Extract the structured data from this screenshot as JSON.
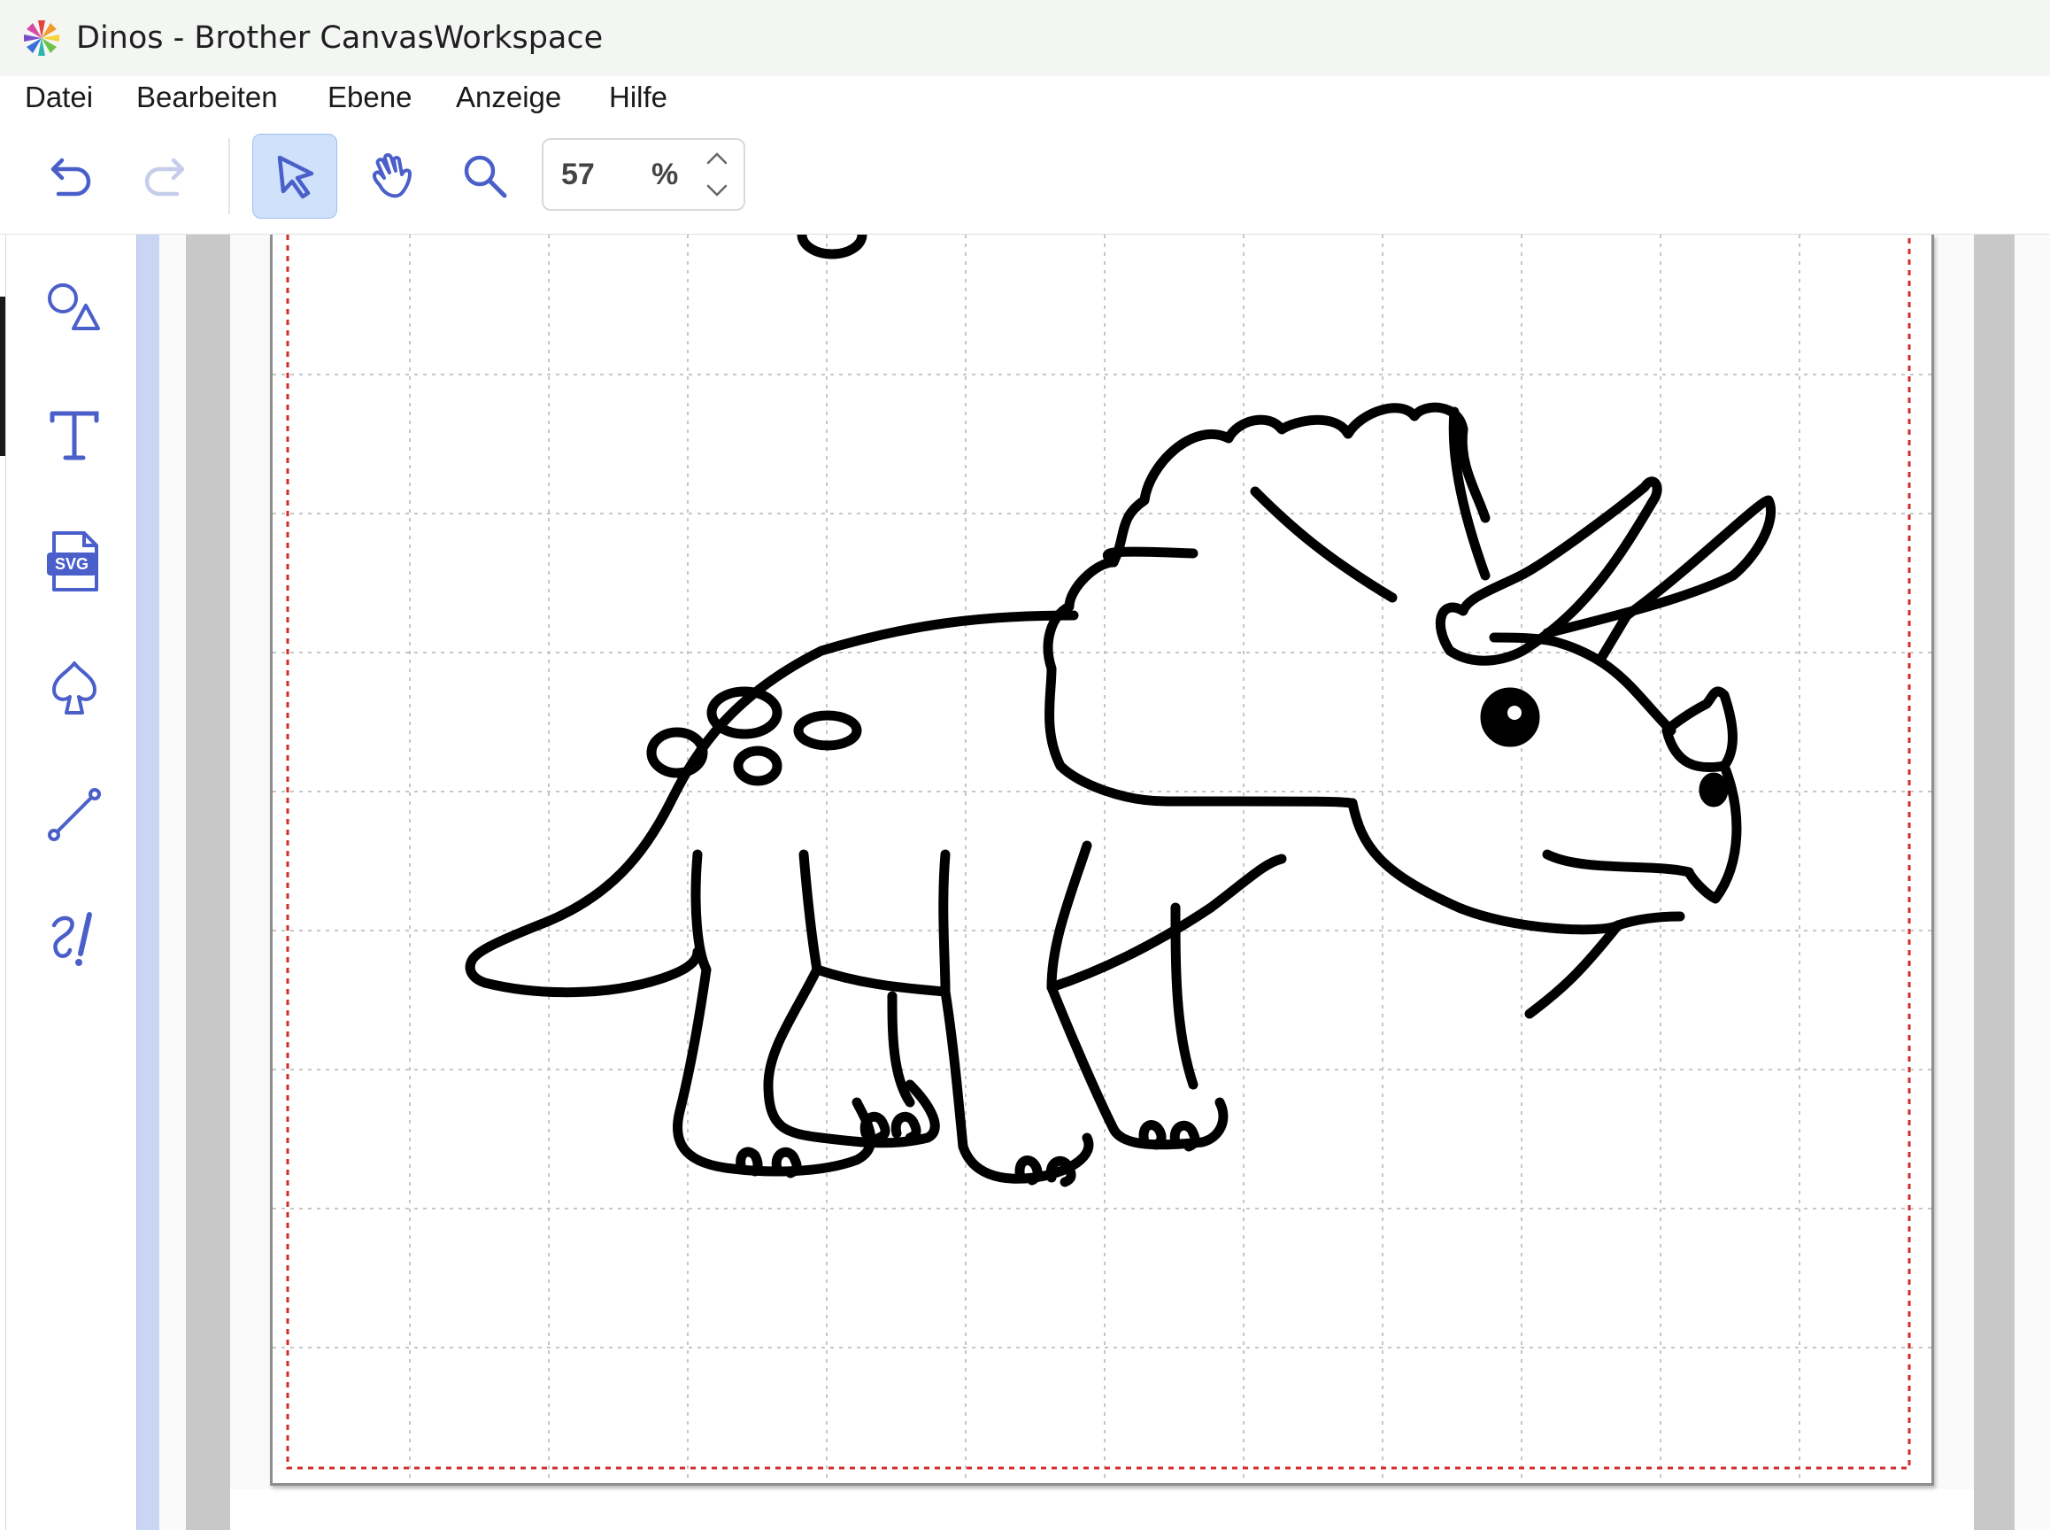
{
  "window": {
    "title": "Dinos - Brother CanvasWorkspace"
  },
  "menu": {
    "items": [
      "Datei",
      "Bearbeiten",
      "Ebene",
      "Anzeige",
      "Hilfe"
    ]
  },
  "toolbar": {
    "tools": [
      {
        "name": "undo",
        "icon": "undo-icon",
        "enabled": true
      },
      {
        "name": "redo",
        "icon": "redo-icon",
        "enabled": false
      },
      {
        "name": "select",
        "icon": "select-arrow-icon",
        "active": true
      },
      {
        "name": "pan",
        "icon": "hand-icon",
        "active": false
      },
      {
        "name": "zoom",
        "icon": "zoom-magnifier-icon",
        "active": false
      }
    ],
    "zoom": {
      "value": "57",
      "unit": "%"
    }
  },
  "sidebar": {
    "tools": [
      {
        "name": "shapes",
        "icon": "shapes-icon"
      },
      {
        "name": "text",
        "icon": "text-icon"
      },
      {
        "name": "svg-import",
        "icon": "svg-file-icon",
        "label": "SVG"
      },
      {
        "name": "pattern",
        "icon": "spade-pattern-icon"
      },
      {
        "name": "line",
        "icon": "line-icon"
      },
      {
        "name": "freehand",
        "icon": "freehand-draw-icon"
      }
    ]
  },
  "canvas": {
    "content": "triceratops outline drawing",
    "grid": true,
    "cut_area_border": "dashed-red"
  },
  "colors": {
    "accent": "#4a5fc9",
    "active_tool_bg": "#cfe1fb",
    "cut_border": "#d42b2b",
    "grid": "#c9c9c9",
    "drawing_stroke": "#000000"
  }
}
